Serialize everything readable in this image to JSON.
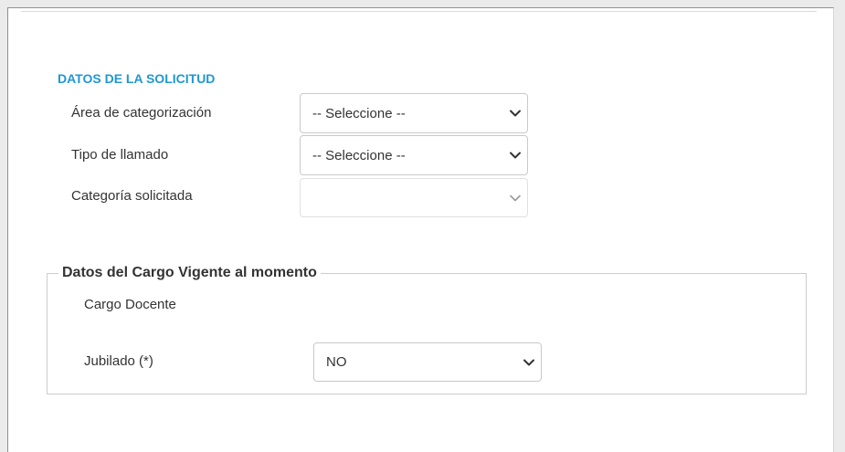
{
  "section": {
    "title": "DATOS DE LA SOLICITUD"
  },
  "fields": [
    {
      "label": "Área de categorización",
      "value": "-- Seleccione --"
    },
    {
      "label": "Tipo de llamado",
      "value": "-- Seleccione --"
    },
    {
      "label": "Categoría solicitada",
      "value": ""
    }
  ],
  "cargo": {
    "legend": "Datos del Cargo Vigente al momento",
    "docente_label": "Cargo Docente",
    "jubilado_label": "Jubilado (*)",
    "jubilado_value": "NO"
  },
  "icons": {
    "dropdown": "chevron-down-icon"
  },
  "colors": {
    "accent": "#1f97d3",
    "text": "#333333"
  }
}
